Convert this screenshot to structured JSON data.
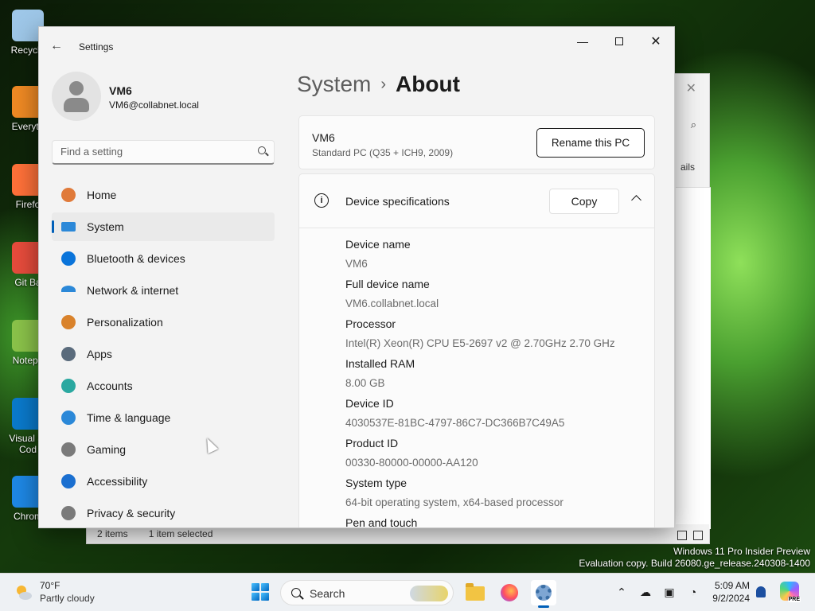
{
  "desktop": {
    "icons": [
      {
        "label": "Recycle",
        "color": "#9ec7e8"
      },
      {
        "label": "Everyth",
        "color": "#f08a24"
      },
      {
        "label": "Firefo",
        "color": "#ff7139"
      },
      {
        "label": "Git Ba",
        "color": "#e74c3c"
      },
      {
        "label": "Notepa",
        "color": "#8bc34a"
      },
      {
        "label": "Visual St\nCod",
        "color": "#0a7acc"
      },
      {
        "label": "Chrom",
        "color": "#1e88e5"
      }
    ],
    "watermark_line1": "Windows 11 Pro Insider Preview",
    "watermark_line2": "Evaluation copy. Build 26080.ge_release.240308-1400"
  },
  "explorer_bg": {
    "close_glyph": "✕",
    "partial_text": "ails",
    "status_items": "2 items",
    "status_selected": "1 item selected"
  },
  "settings": {
    "app_title": "Settings",
    "window_controls": {
      "minimize": "—",
      "close": "✕"
    },
    "user": {
      "name": "VM6",
      "email": "VM6@collabnet.local"
    },
    "search": {
      "placeholder": "Find a setting"
    },
    "nav": [
      {
        "label": "Home",
        "icon": "home-icon",
        "active": false
      },
      {
        "label": "System",
        "icon": "system-icon",
        "active": true
      },
      {
        "label": "Bluetooth & devices",
        "icon": "bluetooth-icon",
        "active": false
      },
      {
        "label": "Network & internet",
        "icon": "wifi-icon",
        "active": false
      },
      {
        "label": "Personalization",
        "icon": "brush-icon",
        "active": false
      },
      {
        "label": "Apps",
        "icon": "apps-icon",
        "active": false
      },
      {
        "label": "Accounts",
        "icon": "accounts-icon",
        "active": false
      },
      {
        "label": "Time & language",
        "icon": "globe-clock-icon",
        "active": false
      },
      {
        "label": "Gaming",
        "icon": "gamepad-icon",
        "active": false
      },
      {
        "label": "Accessibility",
        "icon": "accessibility-icon",
        "active": false
      },
      {
        "label": "Privacy & security",
        "icon": "shield-icon",
        "active": false
      }
    ],
    "breadcrumb": {
      "parent": "System",
      "separator": "›",
      "current": "About"
    },
    "pc": {
      "name": "VM6",
      "model": "Standard PC (Q35 + ICH9, 2009)",
      "rename_label": "Rename this PC"
    },
    "device_specs": {
      "title": "Device specifications",
      "copy_label": "Copy",
      "info_glyph": "i",
      "rows": [
        {
          "label": "Device name",
          "value": "VM6"
        },
        {
          "label": "Full device name",
          "value": "VM6.collabnet.local"
        },
        {
          "label": "Processor",
          "value": "Intel(R) Xeon(R) CPU E5-2697 v2 @ 2.70GHz   2.70 GHz"
        },
        {
          "label": "Installed RAM",
          "value": "8.00 GB"
        },
        {
          "label": "Device ID",
          "value": "4030537E-81BC-4797-86C7-DC366B7C49A5"
        },
        {
          "label": "Product ID",
          "value": "00330-80000-00000-AA120"
        },
        {
          "label": "System type",
          "value": "64-bit operating system, x64-based processor"
        },
        {
          "label": "Pen and touch",
          "value": ""
        }
      ]
    }
  },
  "taskbar": {
    "weather": {
      "temp": "70°F",
      "desc": "Partly cloudy"
    },
    "search_label": "Search",
    "clock": {
      "time": "5:09 AM",
      "date": "9/2/2024"
    },
    "copilot_badge": "PRE"
  }
}
